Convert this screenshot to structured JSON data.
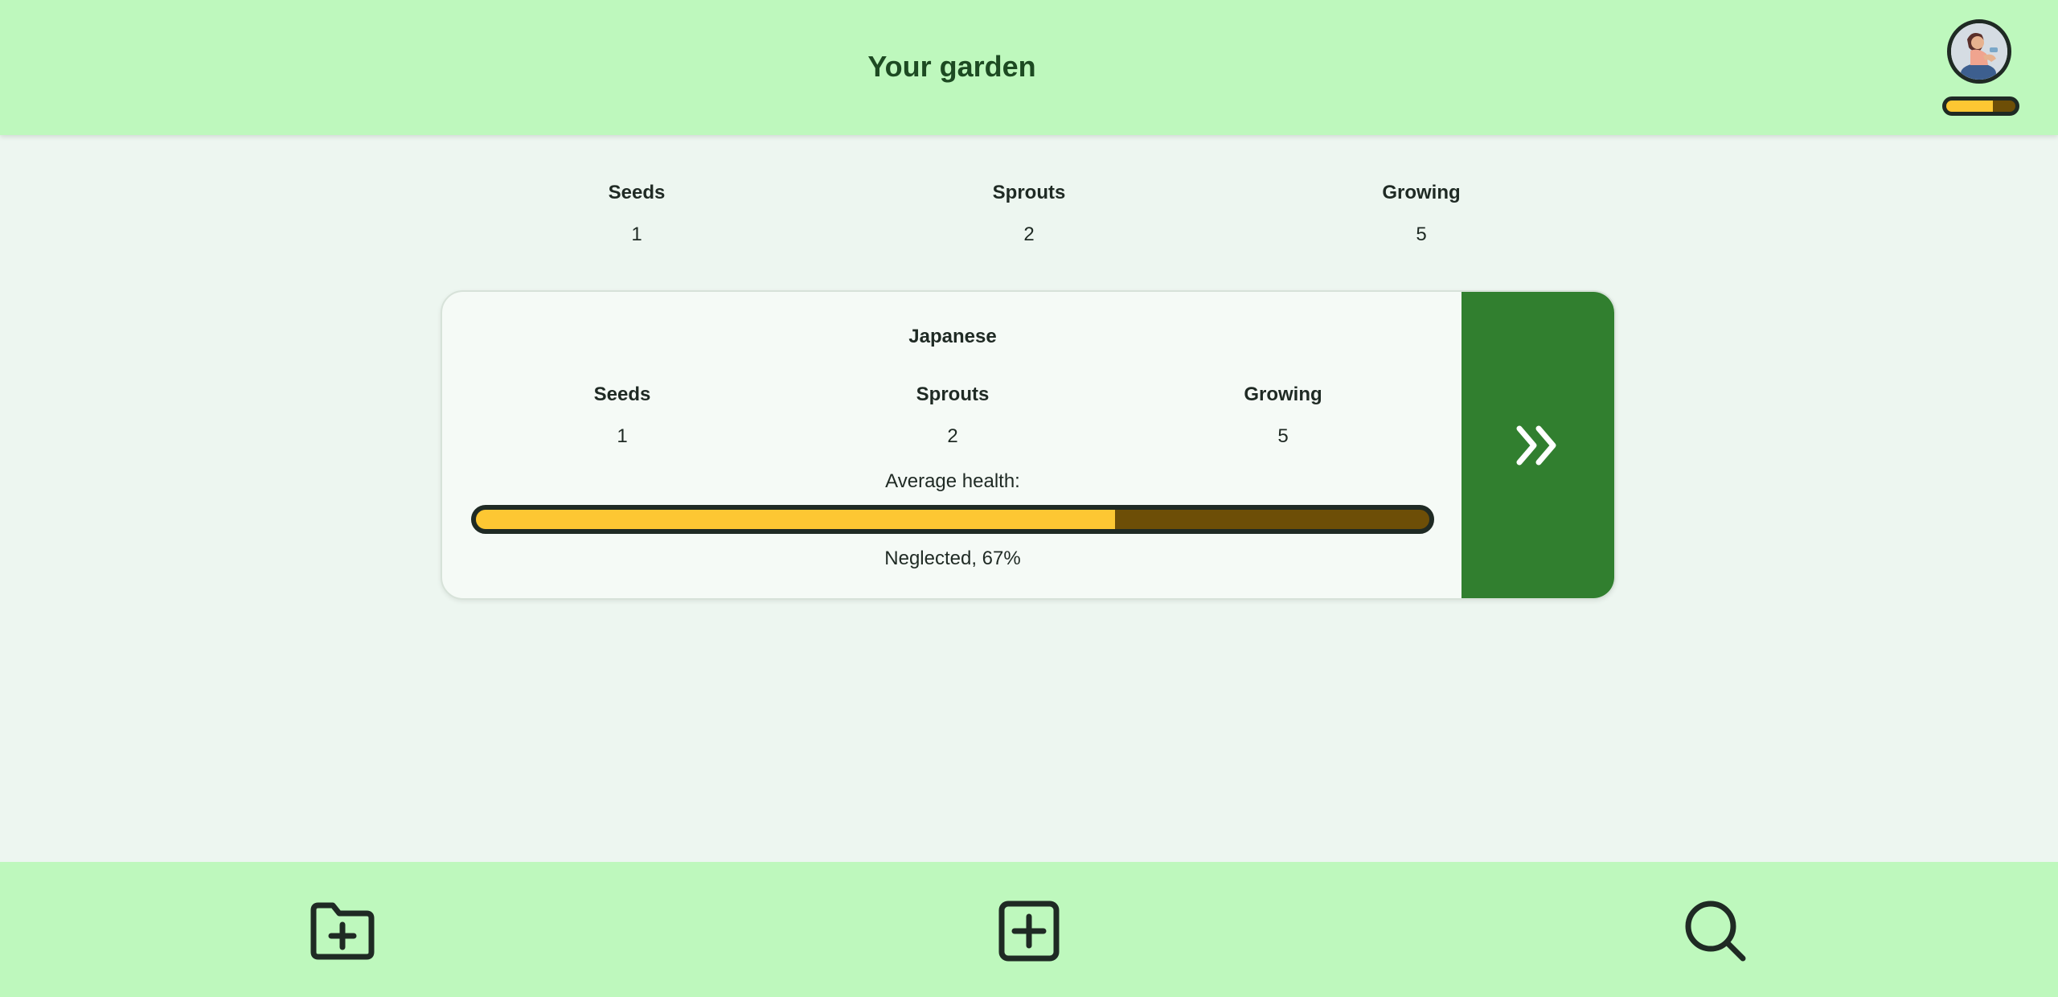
{
  "header": {
    "title": "Your garden",
    "health_fraction": 0.67
  },
  "summary": {
    "stats": [
      {
        "label": "Seeds",
        "value": "1"
      },
      {
        "label": "Sprouts",
        "value": "2"
      },
      {
        "label": "Growing",
        "value": "5"
      }
    ]
  },
  "garden_card": {
    "title": "Japanese",
    "stats": [
      {
        "label": "Seeds",
        "value": "1"
      },
      {
        "label": "Sprouts",
        "value": "2"
      },
      {
        "label": "Growing",
        "value": "5"
      }
    ],
    "avg_health_label": "Average health:",
    "health_text": "Neglected, 67%",
    "health_fraction": 0.67
  },
  "footer": {
    "buttons": [
      {
        "icon": "folder-plus-icon"
      },
      {
        "icon": "square-plus-icon"
      },
      {
        "icon": "search-icon"
      }
    ]
  },
  "colors": {
    "bar_bg": "#bef8bd",
    "page_bg": "#edf6f0",
    "accent_green": "#317f2f",
    "health_fill": "#fdc733",
    "health_empty": "#6d4e07"
  }
}
